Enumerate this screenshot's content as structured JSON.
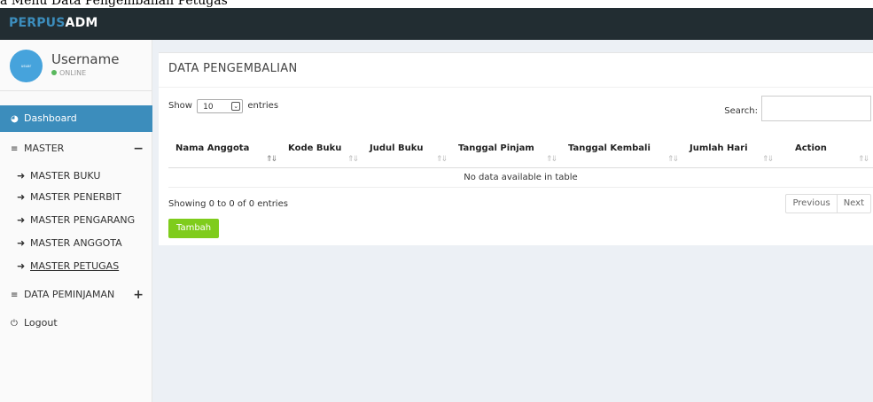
{
  "page_caption": "a Menu Data Pengembalian Petugas",
  "brand": {
    "part1": "PERPUS",
    "part2": "ADM"
  },
  "user": {
    "name": "Username",
    "status": "ONLINE",
    "avatar_text": "usuar"
  },
  "sidebar": {
    "dashboard": "Dashboard",
    "master": {
      "label": "MASTER",
      "toggle": "−"
    },
    "master_items": [
      "MASTER BUKU",
      "MASTER PENERBIT",
      "MASTER PENGARANG",
      "MASTER ANGGOTA",
      "MASTER PETUGAS"
    ],
    "active_item": "MASTER PETUGAS",
    "peminjaman": {
      "label": "DATA PEMINJAMAN",
      "toggle": "+"
    },
    "logout": "Logout"
  },
  "main": {
    "title": "DATA PENGEMBALIAN",
    "length": {
      "prefix": "Show",
      "value": "10",
      "suffix": "entries"
    },
    "search_label": "Search:",
    "columns": [
      "Nama Anggota",
      "Kode Buku",
      "Judul Buku",
      "Tanggal Pinjam",
      "Tanggal Kembali",
      "Jumlah Hari",
      "Action"
    ],
    "empty_message": "No data available in table",
    "info": "Showing 0 to 0 of 0 entries",
    "pager": {
      "previous": "Previous",
      "next": "Next"
    },
    "add_button": "Tambah"
  },
  "colors": {
    "topbar": "#222d32",
    "accent": "#3c8dbc",
    "add_button": "#7fcc1c",
    "online": "#59b85d"
  }
}
